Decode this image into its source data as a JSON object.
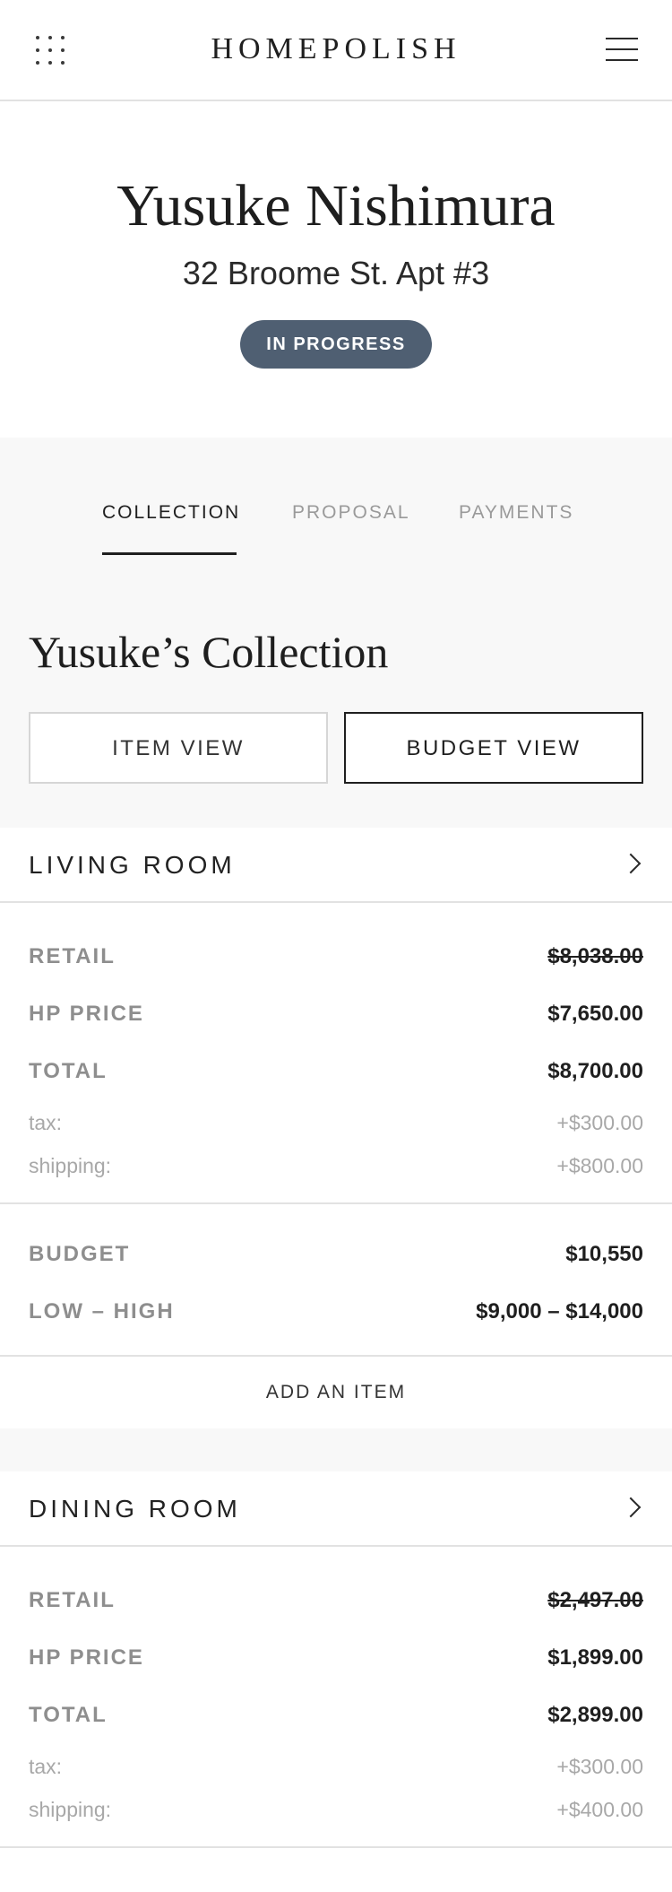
{
  "header": {
    "brand": "HOMEPOLISH",
    "apps_icon": "grid-dots-icon",
    "menu_icon": "hamburger-menu-icon"
  },
  "client": {
    "name": "Yusuke Nishimura",
    "address": "32 Broome St. Apt #3",
    "status": "IN PROGRESS"
  },
  "tabs": [
    {
      "label": "COLLECTION",
      "active": true
    },
    {
      "label": "PROPOSAL",
      "active": false
    },
    {
      "label": "PAYMENTS",
      "active": false
    }
  ],
  "collection": {
    "title": "Yusuke’s Collection",
    "item_view_label": "ITEM VIEW",
    "budget_view_label": "BUDGET VIEW"
  },
  "rooms": [
    {
      "name": "LIVING ROOM",
      "retail_label": "RETAIL",
      "retail": "$8,038.00",
      "hp_price_label": "HP PRICE",
      "hp_price": "$7,650.00",
      "total_label": "TOTAL",
      "total": "$8,700.00",
      "tax_label": "tax:",
      "tax": "+$300.00",
      "shipping_label": "shipping:",
      "shipping": "+$800.00",
      "budget_label": "BUDGET",
      "budget": "$10,550",
      "range_label": "LOW – HIGH",
      "range": "$9,000 – $14,000",
      "add_item_label": "ADD AN ITEM"
    },
    {
      "name": "DINING ROOM",
      "retail_label": "RETAIL",
      "retail": "$2,497.00",
      "hp_price_label": "HP PRICE",
      "hp_price": "$1,899.00",
      "total_label": "TOTAL",
      "total": "$2,899.00",
      "tax_label": "tax:",
      "tax": "+$300.00",
      "shipping_label": "shipping:",
      "shipping": "+$400.00"
    }
  ],
  "colors": {
    "status_badge": "#4f5f72",
    "text_dark": "#1f1f1f",
    "text_muted": "#8e8e8e",
    "background_gray": "#f8f8f8"
  }
}
